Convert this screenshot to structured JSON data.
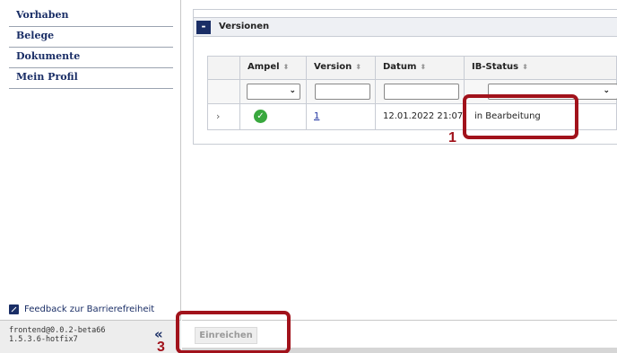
{
  "sidebar": {
    "items": [
      {
        "label": "Vorhaben"
      },
      {
        "label": "Belege"
      },
      {
        "label": "Dokumente"
      },
      {
        "label": "Mein Profil"
      }
    ],
    "feedback_label": "Feedback zur Barrierefreiheit",
    "version_line1": "frontend@0.0.2-beta66",
    "version_line2": "1.5.3.6-hotfix7",
    "collapse_glyph": "«"
  },
  "panel": {
    "toggle_glyph": "-",
    "title": "Versionen"
  },
  "table": {
    "columns": [
      "",
      "Ampel",
      "Version",
      "Datum",
      "IB-Status"
    ],
    "sort_glyph": "⬍",
    "rows": [
      {
        "expand": "›",
        "ampel_icon": "check-circle-icon",
        "version": "1",
        "datum": "12.01.2022 21:07",
        "ib_status": "in Bearbeitung"
      }
    ]
  },
  "footer": {
    "submit_label": "Einreichen"
  },
  "annotations": [
    {
      "number": "1"
    },
    {
      "number": "3"
    }
  ],
  "colors": {
    "navy": "#1a2e66",
    "annotation_red": "#a1121b",
    "ampel_green": "#39a83e"
  }
}
